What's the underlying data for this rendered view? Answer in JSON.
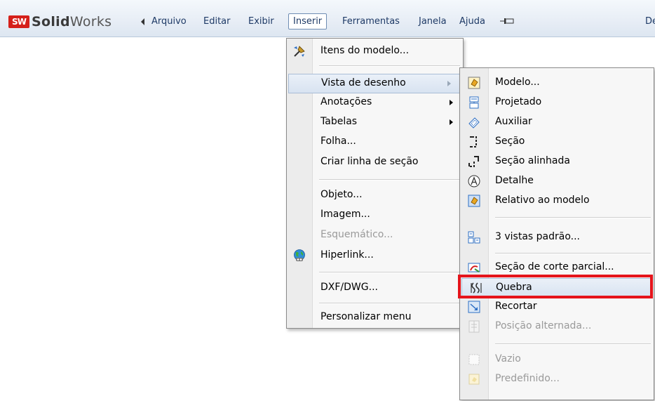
{
  "app": {
    "logo_badge": "SW",
    "logo_name_bold": "Solid",
    "logo_name_light": "Works"
  },
  "menubar": {
    "items": [
      "Arquivo",
      "Editar",
      "Exibir",
      "Inserir",
      "Ferramentas",
      "Janela",
      "Ajuda"
    ],
    "active": "Inserir",
    "right_clip": "De"
  },
  "inserir_menu": {
    "items": [
      {
        "label": "Itens do modelo...",
        "icon": "model-items-icon"
      },
      {
        "label": "Vista de desenho",
        "submenu": true,
        "highlighted": true
      },
      {
        "label": "Anotações",
        "submenu": true
      },
      {
        "label": "Tabelas",
        "submenu": true
      },
      {
        "label": "Folha..."
      },
      {
        "label": "Criar linha de seção"
      },
      {
        "label": "Objeto..."
      },
      {
        "label": "Imagem..."
      },
      {
        "label": "Esquemático...",
        "disabled": true
      },
      {
        "label": "Hiperlink...",
        "icon": "globe-icon"
      },
      {
        "label": "DXF/DWG..."
      },
      {
        "label": "Personalizar menu"
      }
    ]
  },
  "vista_submenu": {
    "items": [
      {
        "label": "Modelo...",
        "icon": "model-view-icon"
      },
      {
        "label": "Projetado",
        "icon": "projected-view-icon"
      },
      {
        "label": "Auxiliar",
        "icon": "auxiliary-view-icon"
      },
      {
        "label": "Seção",
        "icon": "section-view-icon"
      },
      {
        "label": "Seção alinhada",
        "icon": "aligned-section-icon"
      },
      {
        "label": "Detalhe",
        "icon": "detail-view-icon"
      },
      {
        "label": "Relativo ao modelo",
        "icon": "relative-view-icon"
      },
      {
        "label": "3 vistas padrão...",
        "icon": "standard-3-views-icon"
      },
      {
        "label": "Seção de corte parcial...",
        "icon": "broken-out-section-icon"
      },
      {
        "label": "Quebra",
        "icon": "break-icon",
        "highlighted": true
      },
      {
        "label": "Recortar",
        "icon": "crop-icon"
      },
      {
        "label": "Posição alternada...",
        "icon": "alternate-position-icon",
        "disabled": true
      },
      {
        "label": "Vazio",
        "icon": "empty-view-icon",
        "disabled": true
      },
      {
        "label": "Predefinido...",
        "icon": "predefined-view-icon",
        "disabled": true
      }
    ]
  },
  "colors": {
    "callout": "#e5141b",
    "highlight": "#d8e3f1"
  }
}
